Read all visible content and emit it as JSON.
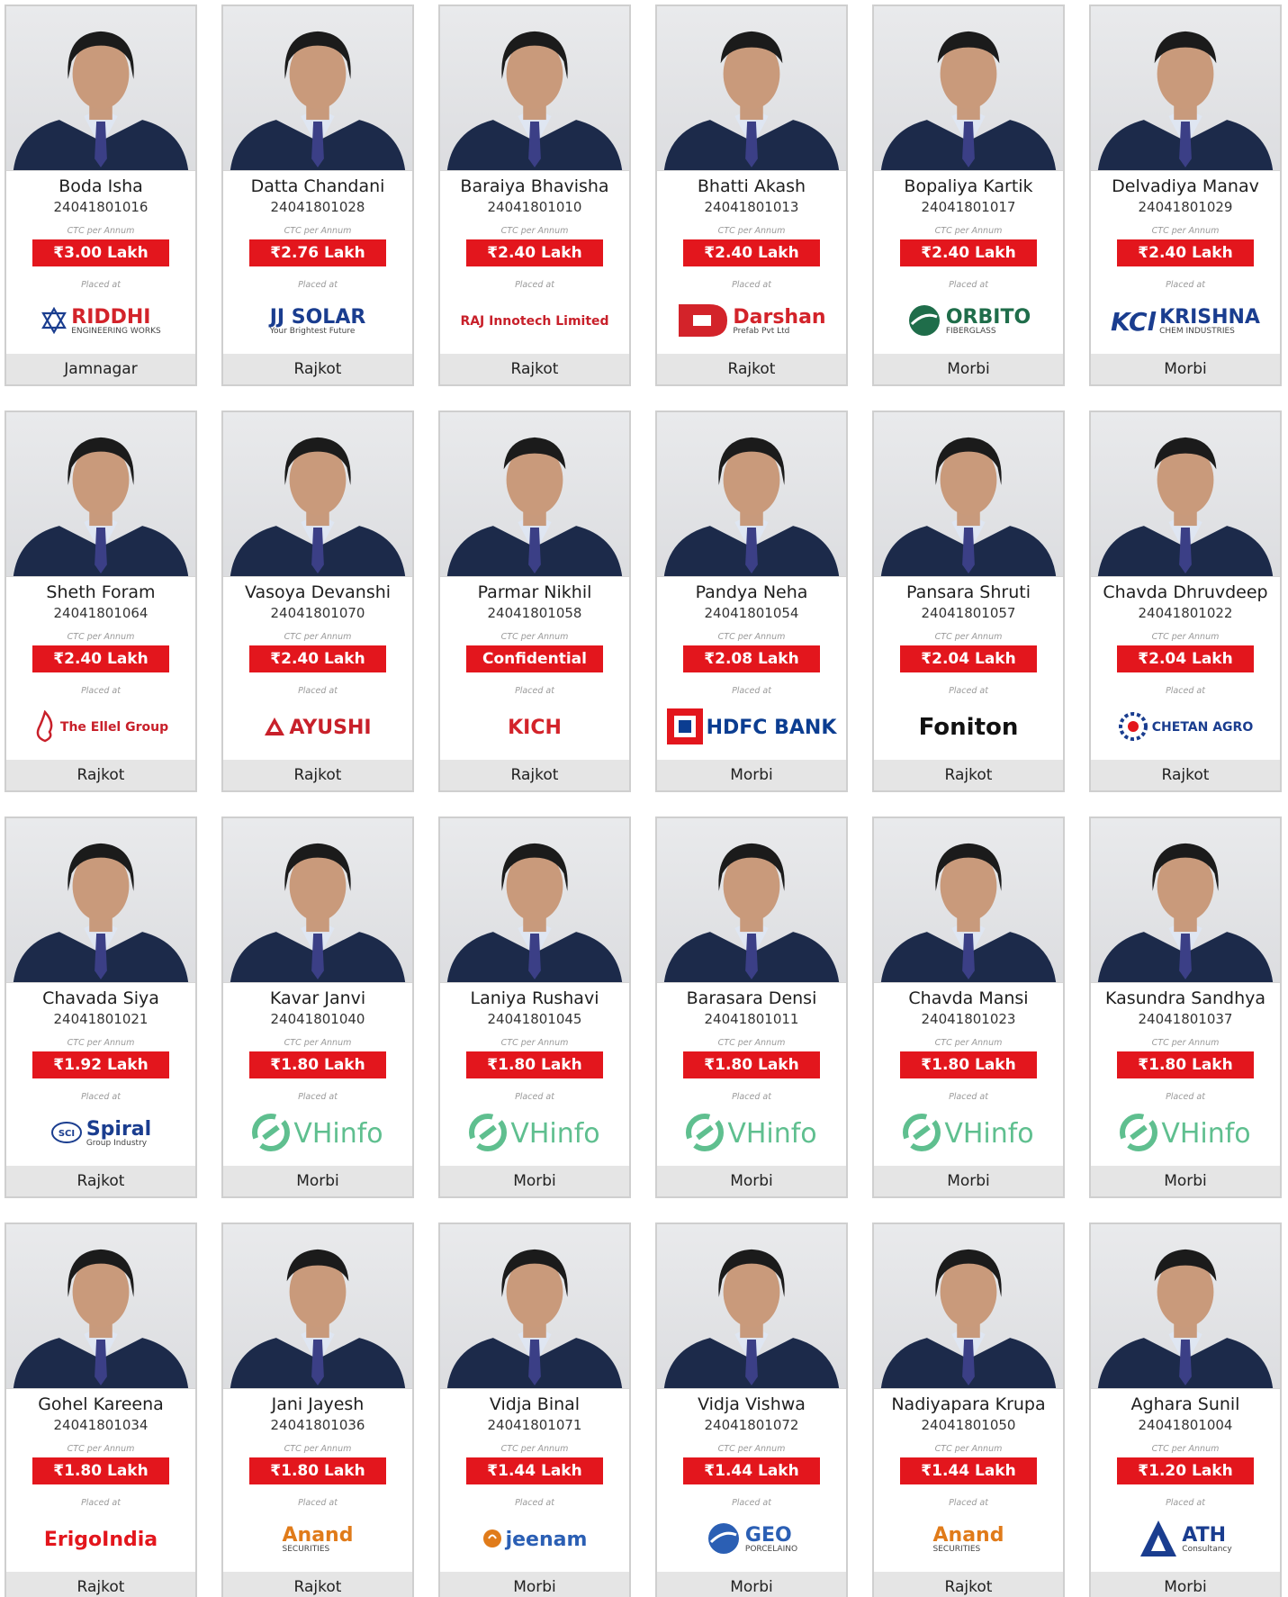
{
  "students": [
    {
      "name": "Boda Isha",
      "roll": "24041801016",
      "ctc_label": "CTC per Annum",
      "salary": "₹3.00 Lakh",
      "placed_label": "Placed at",
      "company": "RIDDHI",
      "company_sub": "ENGINEERING WORKS",
      "logo_icon": "star-icon",
      "logo_color": "#d3232a",
      "city": "Jamnagar",
      "gender": "f"
    },
    {
      "name": "Datta Chandani",
      "roll": "24041801028",
      "ctc_label": "CTC per Annum",
      "salary": "₹2.76 Lakh",
      "placed_label": "Placed at",
      "company": "JJ SOLAR",
      "company_sub": "Your Brightest Future",
      "logo_icon": "sun-icon",
      "logo_color": "#1a3d8f",
      "city": "Rajkot",
      "gender": "f"
    },
    {
      "name": "Baraiya Bhavisha",
      "roll": "24041801010",
      "ctc_label": "CTC per Annum",
      "salary": "₹2.40 Lakh",
      "placed_label": "Placed at",
      "company": "RAJ Innotech Limited",
      "company_sub": "",
      "logo_icon": "raj-icon",
      "logo_color": "#c8202a",
      "city": "Rajkot",
      "gender": "f"
    },
    {
      "name": "Bhatti Akash",
      "roll": "24041801013",
      "ctc_label": "CTC per Annum",
      "salary": "₹2.40 Lakh",
      "placed_label": "Placed at",
      "company": "Darshan",
      "company_sub": "Prefab Pvt Ltd",
      "logo_icon": "d-block-icon",
      "logo_color": "#d3232a",
      "city": "Rajkot",
      "gender": "m"
    },
    {
      "name": "Bopaliya Kartik",
      "roll": "24041801017",
      "ctc_label": "CTC per Annum",
      "salary": "₹2.40 Lakh",
      "placed_label": "Placed at",
      "company": "ORBITO",
      "company_sub": "FIBERGLASS",
      "logo_icon": "globe-icon",
      "logo_color": "#1f6d4a",
      "city": "Morbi",
      "gender": "m"
    },
    {
      "name": "Delvadiya Manav",
      "roll": "24041801029",
      "ctc_label": "CTC per Annum",
      "salary": "₹2.40 Lakh",
      "placed_label": "Placed at",
      "company": "KRISHNA",
      "company_sub": "CHEM INDUSTRIES",
      "logo_icon": "kci-icon",
      "logo_color": "#1a3d8f",
      "city": "Morbi",
      "gender": "m"
    },
    {
      "name": "Sheth Foram",
      "roll": "24041801064",
      "ctc_label": "CTC per Annum",
      "salary": "₹2.40 Lakh",
      "placed_label": "Placed at",
      "company": "The Ellel Group",
      "company_sub": "",
      "logo_icon": "flame-icon",
      "logo_color": "#c8202a",
      "city": "Rajkot",
      "gender": "f"
    },
    {
      "name": "Vasoya Devanshi",
      "roll": "24041801070",
      "ctc_label": "CTC per Annum",
      "salary": "₹2.40 Lakh",
      "placed_label": "Placed at",
      "company": "AYUSHI",
      "company_sub": "",
      "logo_icon": "triangle-icon",
      "logo_color": "#c8202a",
      "city": "Rajkot",
      "gender": "f"
    },
    {
      "name": "Parmar Nikhil",
      "roll": "24041801058",
      "ctc_label": "CTC per Annum",
      "salary": "Confidential",
      "placed_label": "Placed at",
      "company": "KICH",
      "company_sub": "",
      "logo_icon": "kich-icon",
      "logo_color": "#d3232a",
      "city": "Rajkot",
      "gender": "m"
    },
    {
      "name": "Pandya Neha",
      "roll": "24041801054",
      "ctc_label": "CTC per Annum",
      "salary": "₹2.08 Lakh",
      "placed_label": "Placed at",
      "company": "HDFC BANK",
      "company_sub": "",
      "logo_icon": "hdfc-icon",
      "logo_color": "#0b3d91",
      "city": "Morbi",
      "gender": "f"
    },
    {
      "name": "Pansara Shruti",
      "roll": "24041801057",
      "ctc_label": "CTC per Annum",
      "salary": "₹2.04 Lakh",
      "placed_label": "Placed at",
      "company": "Foniton",
      "company_sub": "",
      "logo_icon": "",
      "logo_color": "#111111",
      "city": "Rajkot",
      "gender": "f"
    },
    {
      "name": "Chavda Dhruvdeep",
      "roll": "24041801022",
      "ctc_label": "CTC per Annum",
      "salary": "₹2.04 Lakh",
      "placed_label": "Placed at",
      "company": "CHETAN AGRO",
      "company_sub": "",
      "logo_icon": "gear-icon",
      "logo_color": "#1a3d8f",
      "city": "Rajkot",
      "gender": "m"
    },
    {
      "name": "Chavada Siya",
      "roll": "24041801021",
      "ctc_label": "CTC per Annum",
      "salary": "₹1.92 Lakh",
      "placed_label": "Placed at",
      "company": "Spiral",
      "company_sub": "Group Industry",
      "logo_icon": "sci-icon",
      "logo_color": "#1a3d8f",
      "city": "Rajkot",
      "gender": "f"
    },
    {
      "name": "Kavar Janvi",
      "roll": "24041801040",
      "ctc_label": "CTC per Annum",
      "salary": "₹1.80 Lakh",
      "placed_label": "Placed at",
      "company": "VHinfo",
      "company_sub": "",
      "logo_icon": "link-icon",
      "logo_color": "#5fbf8f",
      "city": "Morbi",
      "gender": "f"
    },
    {
      "name": "Laniya Rushavi",
      "roll": "24041801045",
      "ctc_label": "CTC per Annum",
      "salary": "₹1.80 Lakh",
      "placed_label": "Placed at",
      "company": "VHinfo",
      "company_sub": "",
      "logo_icon": "link-icon",
      "logo_color": "#5fbf8f",
      "city": "Morbi",
      "gender": "f"
    },
    {
      "name": "Barasara Densi",
      "roll": "24041801011",
      "ctc_label": "CTC per Annum",
      "salary": "₹1.80 Lakh",
      "placed_label": "Placed at",
      "company": "VHinfo",
      "company_sub": "",
      "logo_icon": "link-icon",
      "logo_color": "#5fbf8f",
      "city": "Morbi",
      "gender": "f"
    },
    {
      "name": "Chavda Mansi",
      "roll": "24041801023",
      "ctc_label": "CTC per Annum",
      "salary": "₹1.80 Lakh",
      "placed_label": "Placed at",
      "company": "VHinfo",
      "company_sub": "",
      "logo_icon": "link-icon",
      "logo_color": "#5fbf8f",
      "city": "Morbi",
      "gender": "f"
    },
    {
      "name": "Kasundra Sandhya",
      "roll": "24041801037",
      "ctc_label": "CTC per Annum",
      "salary": "₹1.80 Lakh",
      "placed_label": "Placed at",
      "company": "VHinfo",
      "company_sub": "",
      "logo_icon": "link-icon",
      "logo_color": "#5fbf8f",
      "city": "Morbi",
      "gender": "f"
    },
    {
      "name": "Gohel Kareena",
      "roll": "24041801034",
      "ctc_label": "CTC per Annum",
      "salary": "₹1.80 Lakh",
      "placed_label": "Placed at",
      "company": "ErigoIndia",
      "company_sub": "",
      "logo_icon": "erigo-icon",
      "logo_color": "#e3161d",
      "city": "Rajkot",
      "gender": "f"
    },
    {
      "name": "Jani Jayesh",
      "roll": "24041801036",
      "ctc_label": "CTC per Annum",
      "salary": "₹1.80 Lakh",
      "placed_label": "Placed at",
      "company": "Anand",
      "company_sub": "SECURITIES",
      "logo_icon": "anand-icon",
      "logo_color": "#e07b1a",
      "city": "Rajkot",
      "gender": "m"
    },
    {
      "name": "Vidja Binal",
      "roll": "24041801071",
      "ctc_label": "CTC per Annum",
      "salary": "₹1.44 Lakh",
      "placed_label": "Placed at",
      "company": "jeenam",
      "company_sub": "",
      "logo_icon": "jeenam-icon",
      "logo_color": "#2b5fb4",
      "city": "Morbi",
      "gender": "f"
    },
    {
      "name": "Vidja Vishwa",
      "roll": "24041801072",
      "ctc_label": "CTC per Annum",
      "salary": "₹1.44 Lakh",
      "placed_label": "Placed at",
      "company": "GEO",
      "company_sub": "PORCELAINO",
      "logo_icon": "globe-icon",
      "logo_color": "#2b5fb4",
      "city": "Morbi",
      "gender": "f"
    },
    {
      "name": "Nadiyapara Krupa",
      "roll": "24041801050",
      "ctc_label": "CTC per Annum",
      "salary": "₹1.44 Lakh",
      "placed_label": "Placed at",
      "company": "Anand",
      "company_sub": "SECURITIES",
      "logo_icon": "anand-icon",
      "logo_color": "#e07b1a",
      "city": "Rajkot",
      "gender": "f"
    },
    {
      "name": "Aghara Sunil",
      "roll": "24041801004",
      "ctc_label": "CTC per Annum",
      "salary": "₹1.20 Lakh",
      "placed_label": "Placed at",
      "company": "ATH",
      "company_sub": "Consultancy",
      "logo_icon": "ath-icon",
      "logo_color": "#1a3d8f",
      "city": "Morbi",
      "gender": "m"
    }
  ]
}
